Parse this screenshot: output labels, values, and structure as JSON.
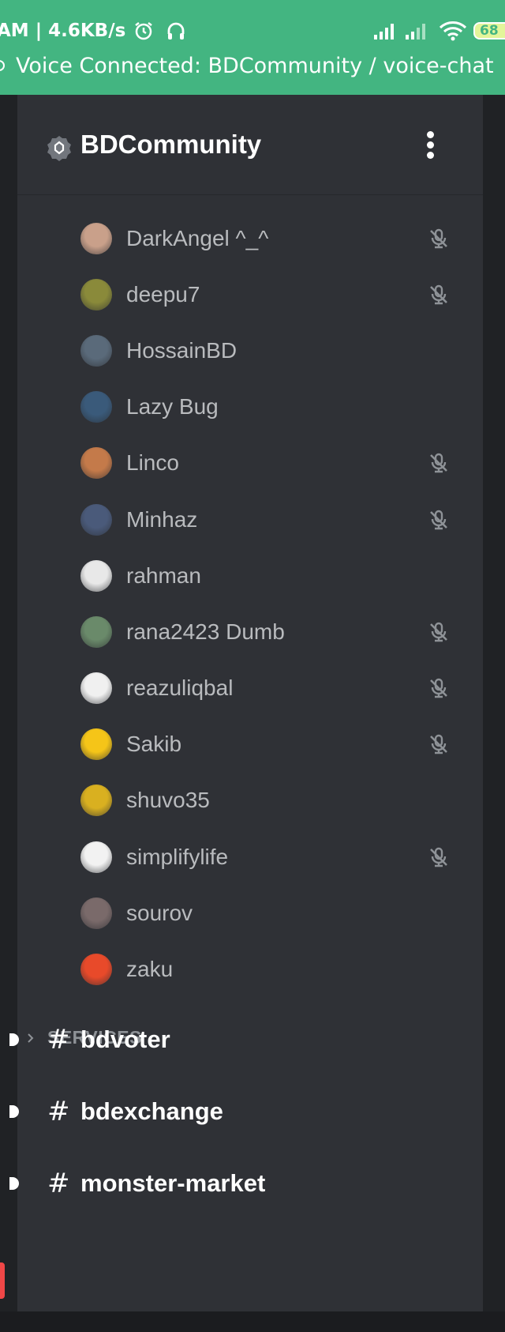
{
  "status_bar": {
    "time_speed": "AM | 4.6KB/s",
    "battery": "68",
    "voice_connected": "Voice Connected: BDCommunity / voice-chat"
  },
  "server": {
    "name": "BDCommunity"
  },
  "voice_users": [
    {
      "name": "DarkAngel ^_^",
      "muted": true,
      "avatar_color": "#c9a08a"
    },
    {
      "name": "deepu7",
      "muted": true,
      "avatar_color": "#8a8a3a"
    },
    {
      "name": "HossainBD",
      "muted": false,
      "avatar_color": "#5a6a7a"
    },
    {
      "name": "Lazy Bug",
      "muted": false,
      "avatar_color": "#3a5a7a"
    },
    {
      "name": "Linco",
      "muted": true,
      "avatar_color": "#c47a4a"
    },
    {
      "name": "Minhaz",
      "muted": true,
      "avatar_color": "#4a5a7a"
    },
    {
      "name": "rahman",
      "muted": false,
      "avatar_color": "#e8e8e8"
    },
    {
      "name": "rana2423 Dumb",
      "muted": true,
      "avatar_color": "#6a8a6a"
    },
    {
      "name": "reazuliqbal",
      "muted": true,
      "avatar_color": "#f0f0f0"
    },
    {
      "name": "Sakib",
      "muted": true,
      "avatar_color": "#f5c518"
    },
    {
      "name": "shuvo35",
      "muted": false,
      "avatar_color": "#d9b020"
    },
    {
      "name": "simplifylife",
      "muted": true,
      "avatar_color": "#f2f2f2"
    },
    {
      "name": "sourov",
      "muted": false,
      "avatar_color": "#7a6a6a"
    },
    {
      "name": "zaku",
      "muted": false,
      "avatar_color": "#e84a2a"
    }
  ],
  "category": {
    "label": "SERVICES"
  },
  "channels": [
    {
      "name": "bdvoter"
    },
    {
      "name": "bdexchange"
    },
    {
      "name": "monster-market"
    }
  ],
  "colors": {
    "accent": "#43b581",
    "panel": "#2f3136",
    "background": "#202225"
  }
}
